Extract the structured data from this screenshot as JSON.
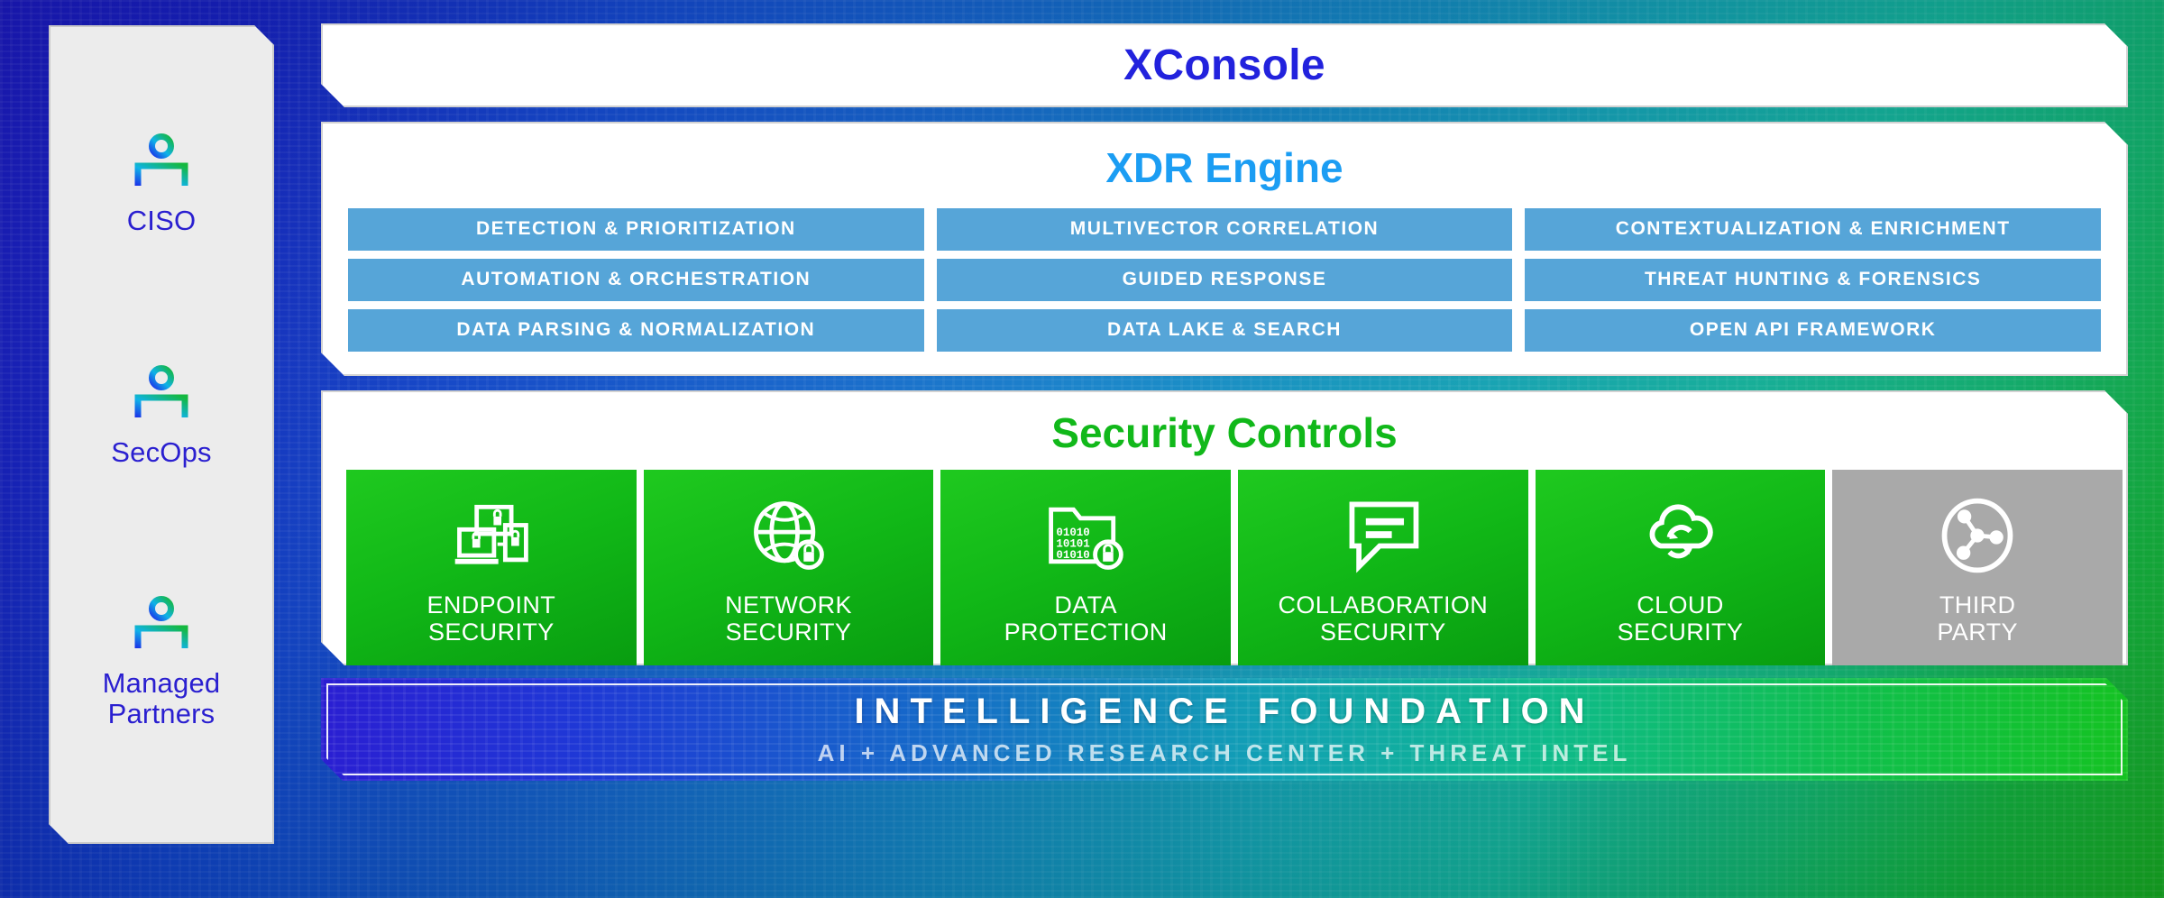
{
  "theme": {
    "bg_blue": "#1a18c8",
    "bg_green": "#17b524",
    "console_blue": "#2222dd",
    "xdr_blue": "#1b9df3",
    "controls_green": "#11b81a",
    "capability_blue": "#56a5d8",
    "tile_green": "#11b817",
    "tile_gray": "#a9a9a9",
    "panel_white": "#ffffff",
    "sidebar_gray": "#ececec"
  },
  "sidebar": {
    "personas": [
      {
        "label": "CISO",
        "icon": "person-icon"
      },
      {
        "label": "SecOps",
        "icon": "person-icon"
      },
      {
        "label": "Managed\nPartners",
        "icon": "person-icon"
      }
    ]
  },
  "console": {
    "title": "XConsole"
  },
  "xdr": {
    "title": "XDR Engine",
    "capabilities": [
      "DETECTION & PRIORITIZATION",
      "MULTIVECTOR CORRELATION",
      "CONTEXTUALIZATION & ENRICHMENT",
      "AUTOMATION & ORCHESTRATION",
      "GUIDED RESPONSE",
      "THREAT HUNTING & FORENSICS",
      "DATA PARSING & NORMALIZATION",
      "DATA LAKE & SEARCH",
      "OPEN API FRAMEWORK"
    ]
  },
  "security_controls": {
    "title": "Security Controls",
    "tiles": [
      {
        "label": "ENDPOINT\nSECURITY",
        "icon": "devices-lock-icon",
        "style": "green"
      },
      {
        "label": "NETWORK\nSECURITY",
        "icon": "globe-lock-icon",
        "style": "green"
      },
      {
        "label": "DATA\nPROTECTION",
        "icon": "folder-binary-lock-icon",
        "style": "green"
      },
      {
        "label": "COLLABORATION\nSECURITY",
        "icon": "speech-bubble-icon",
        "style": "green"
      },
      {
        "label": "CLOUD\nSECURITY",
        "icon": "cloud-sync-icon",
        "style": "green"
      },
      {
        "label": "THIRD\nPARTY",
        "icon": "network-nodes-circle-icon",
        "style": "gray"
      }
    ]
  },
  "foundation": {
    "title": "INTELLIGENCE FOUNDATION",
    "subtitle": "AI  +  ADVANCED RESEARCH CENTER  +  THREAT INTEL"
  }
}
